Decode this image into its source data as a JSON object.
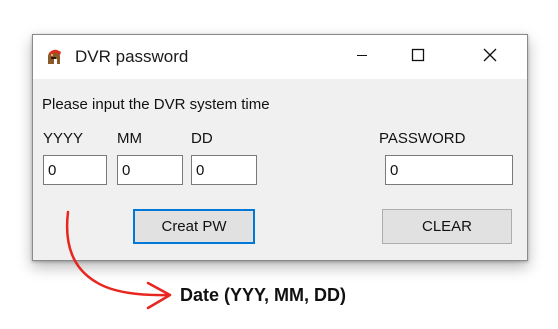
{
  "window": {
    "title": "DVR password",
    "app_icon": "spartan-helmet-icon",
    "controls": {
      "minimize": "minimize-icon",
      "maximize": "maximize-icon",
      "close": "close-icon"
    }
  },
  "form": {
    "prompt": "Please input the DVR system time",
    "fields": {
      "year": {
        "label": "YYYY",
        "value": "0"
      },
      "month": {
        "label": "MM",
        "value": "0"
      },
      "day": {
        "label": "DD",
        "value": "0"
      },
      "password": {
        "label": "PASSWORD",
        "value": "0"
      }
    },
    "buttons": {
      "create": "Creat PW",
      "clear": "CLEAR"
    }
  },
  "annotation": {
    "text": "Date (YYY, MM, DD)",
    "arrow_color": "#e8251e"
  },
  "colors": {
    "focus_border": "#0078d7",
    "window_bg": "#f0f0f0",
    "titlebar_bg": "#ffffff"
  }
}
